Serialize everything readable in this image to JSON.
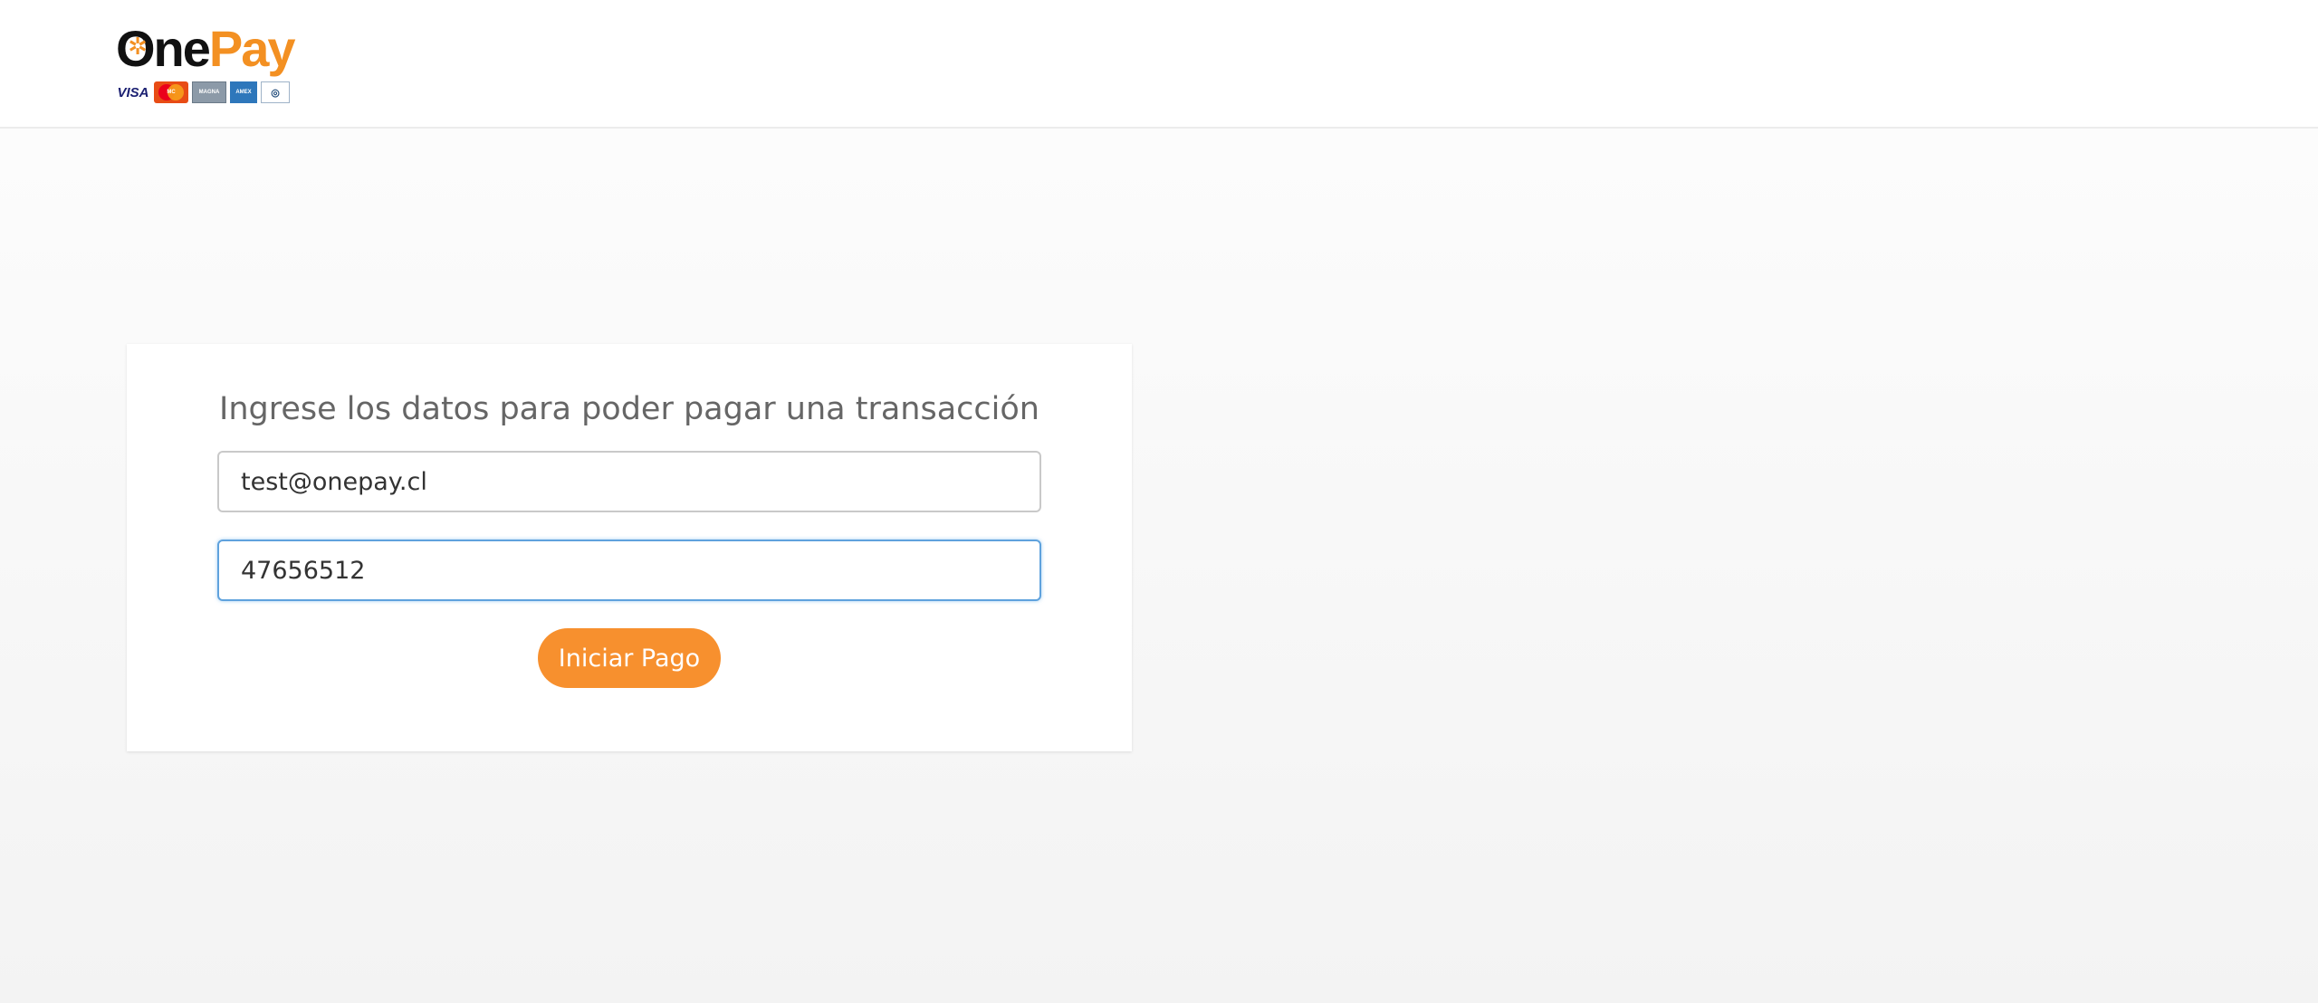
{
  "header": {
    "logo": {
      "brand_part1": "One",
      "brand_part2": "Pay",
      "accent_color": "#f39022",
      "star_icon": "✲",
      "card_brands": [
        "VISA",
        "MasterCard",
        "MAGNA",
        "AMERICAN EXPRESS",
        "Diners Club"
      ]
    }
  },
  "form": {
    "title": "Ingrese los datos para poder pagar una transacción",
    "email_value": "test@onepay.cl",
    "code_value": "47656512",
    "submit_label": "Iniciar Pago",
    "button_color": "#f7902e",
    "focus_color": "#5fa2dd"
  }
}
